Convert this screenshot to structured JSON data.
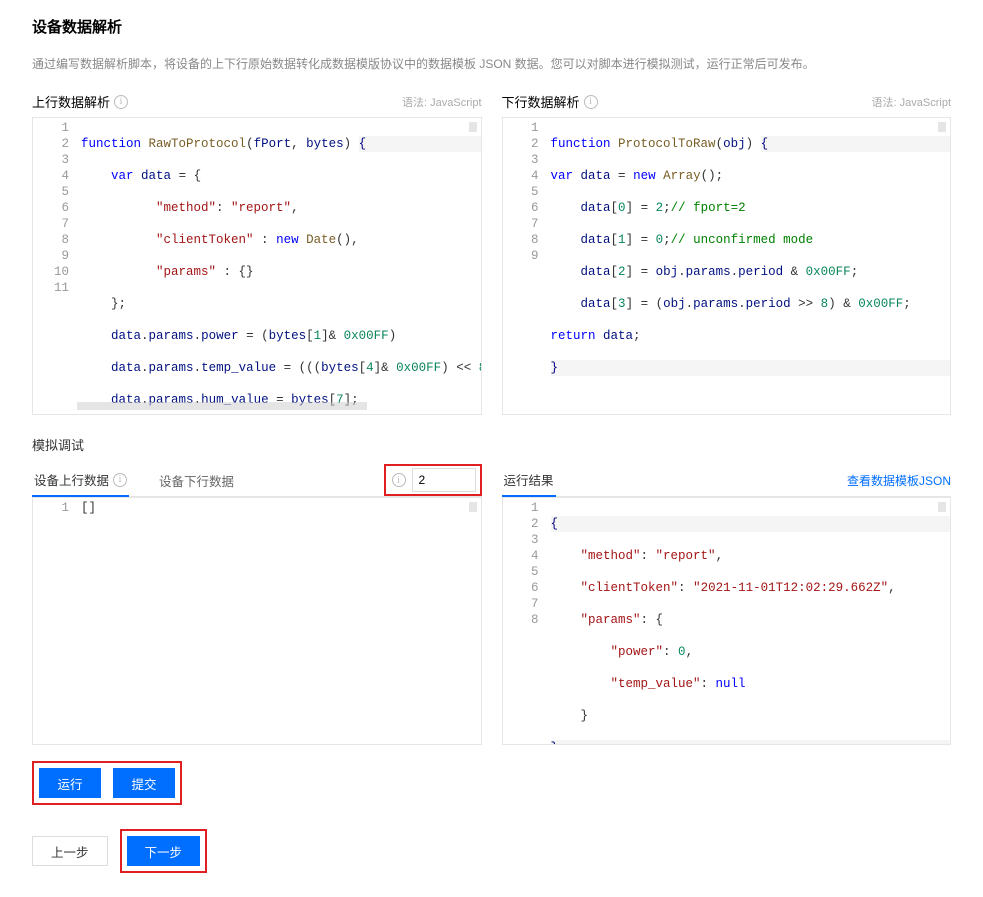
{
  "page": {
    "title": "设备数据解析",
    "desc": "通过编写数据解析脚本，将设备的上下行原始数据转化成数据模版协议中的数据模板 JSON 数据。您可以对脚本进行模拟测试，运行正常后可发布。"
  },
  "uplink": {
    "title": "上行数据解析",
    "lang": "语法: JavaScript"
  },
  "downlink": {
    "title": "下行数据解析",
    "lang": "语法: JavaScript"
  },
  "sim": {
    "title": "模拟调试",
    "tab_upload": "设备上行数据",
    "tab_download": "设备下行数据",
    "fport_value": "2",
    "result_title": "运行结果",
    "json_link": "查看数据模板JSON",
    "btn_run": "运行",
    "btn_submit": "提交"
  },
  "nav": {
    "prev": "上一步",
    "next": "下一步"
  }
}
